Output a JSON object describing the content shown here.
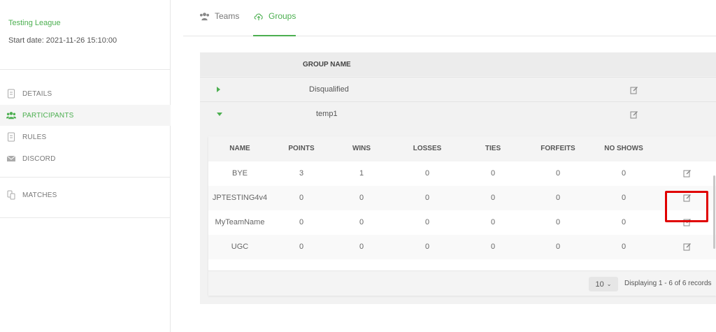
{
  "sidebar": {
    "league_title": "Testing League",
    "start_date": "Start date: 2021-11-26 15:10:00",
    "items": [
      {
        "label": "DETAILS",
        "icon": "document-icon"
      },
      {
        "label": "PARTICIPANTS",
        "icon": "users-icon",
        "active": true
      },
      {
        "label": "RULES",
        "icon": "document-icon"
      },
      {
        "label": "DISCORD",
        "icon": "envelope-icon"
      },
      {
        "label": "MATCHES",
        "icon": "matches-icon"
      }
    ]
  },
  "tabs": [
    {
      "label": "Teams",
      "icon": "users-icon"
    },
    {
      "label": "Groups",
      "icon": "cloud-icon",
      "active": true
    }
  ],
  "groups": {
    "header": "GROUP NAME",
    "rows": [
      {
        "name": "Disqualified",
        "expanded": false
      },
      {
        "name": "temp1",
        "expanded": true
      }
    ]
  },
  "table": {
    "columns": [
      "NAME",
      "POINTS",
      "WINS",
      "LOSSES",
      "TIES",
      "FORFEITS",
      "NO SHOWS"
    ],
    "rows": [
      [
        "BYE",
        "3",
        "1",
        "0",
        "0",
        "0",
        "0"
      ],
      [
        "JPTESTING4v4",
        "0",
        "0",
        "0",
        "0",
        "0",
        "0"
      ],
      [
        "MyTeamName",
        "0",
        "0",
        "0",
        "0",
        "0",
        "0"
      ],
      [
        "UGC",
        "0",
        "0",
        "0",
        "0",
        "0",
        "0"
      ]
    ]
  },
  "pagination": {
    "page_size": "10",
    "records_text": "Displaying 1 - 6 of 6 records"
  },
  "colors": {
    "accent": "#4caf50",
    "highlight": "#e00000"
  }
}
